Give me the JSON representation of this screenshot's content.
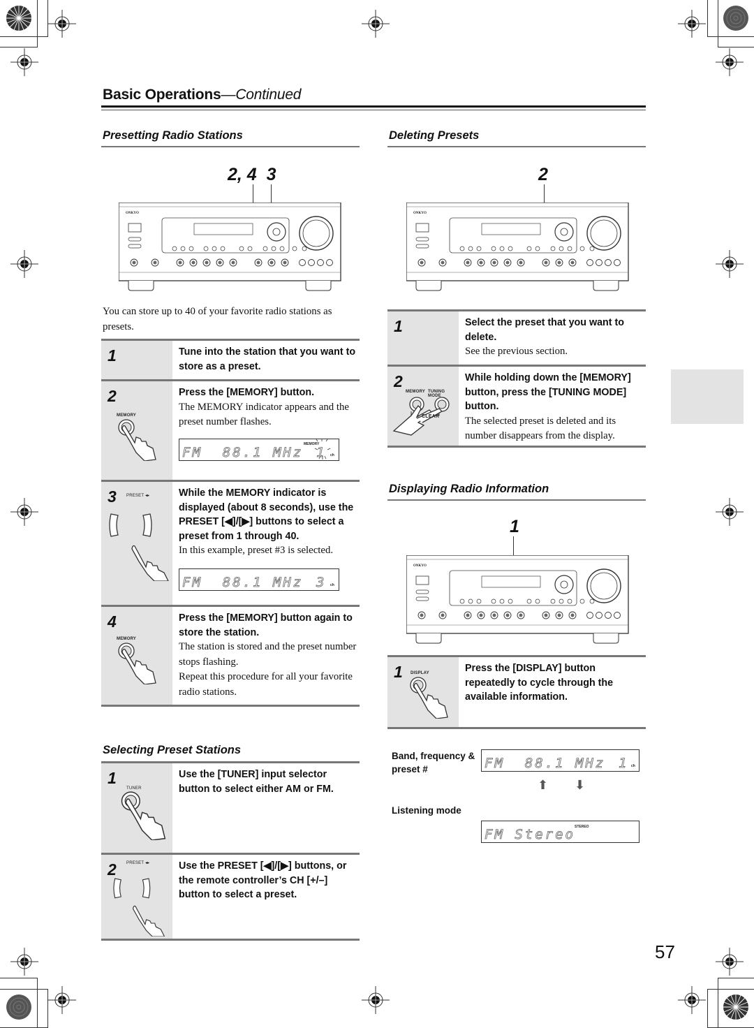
{
  "header": {
    "title": "Basic Operations",
    "continued": "—Continued"
  },
  "presetting": {
    "title": "Presetting Radio Stations",
    "callout": "2, 4  3",
    "receiver": {
      "brand": "ONKYO"
    },
    "intro": "You can store up to 40 of your favorite radio stations as presets.",
    "steps": [
      {
        "num": "1",
        "bold": "Tune into the station that you want to store as a preset.",
        "body": []
      },
      {
        "num": "2",
        "icon_label": "MEMORY",
        "bold": "Press the [MEMORY] button.",
        "body": [
          "The MEMORY indicator appears and the preset number flashes."
        ],
        "display": {
          "text": "FM  88.1 MHz",
          "preset": "1",
          "indicator": "MEMORY",
          "unit": "ch"
        }
      },
      {
        "num": "3",
        "icon_label": "PRESET ◂▸",
        "bold": "While the MEMORY indicator is displayed (about 8 seconds), use the PRESET [◀]/[▶] buttons to select a preset from 1 through 40.",
        "body": [
          "In this example, preset #3 is selected."
        ],
        "display": {
          "text": "FM  88.1 MHz",
          "preset": "3",
          "unit": "ch"
        }
      },
      {
        "num": "4",
        "icon_label": "MEMORY",
        "bold": "Press the [MEMORY] button again to store the station.",
        "body": [
          "The station is stored and the preset number stops flashing.",
          "Repeat this procedure for all your favorite radio stations."
        ]
      }
    ]
  },
  "selecting": {
    "title": "Selecting Preset Stations",
    "steps": [
      {
        "num": "1",
        "icon_label": "TUNER",
        "bold": "Use the [TUNER] input selector button to select either AM or FM."
      },
      {
        "num": "2",
        "icon_label": "PRESET ◂▸",
        "bold": "Use the PRESET [◀]/[▶] buttons, or the remote controller’s CH [+/–] button to select a preset."
      }
    ]
  },
  "deleting": {
    "title": "Deleting Presets",
    "callout": "2",
    "steps": [
      {
        "num": "1",
        "bold": "Select the preset that you want to delete.",
        "body": [
          "See the previous section."
        ]
      },
      {
        "num": "2",
        "icon_labels": [
          "MEMORY",
          "TUNING MODE"
        ],
        "clear_label": "CLEAR",
        "bold": "While holding down the [MEMORY] button, press the [TUNING MODE] button.",
        "body": [
          "The selected preset is deleted and its number disappears from the display."
        ]
      }
    ]
  },
  "displaying": {
    "title": "Displaying Radio Information",
    "callout": "1",
    "steps": [
      {
        "num": "1",
        "icon_label": "DISPLAY",
        "bold": "Press the [DISPLAY] button repeatedly to cycle through the available information."
      }
    ],
    "info": [
      {
        "label": "Band, frequency & preset #",
        "display": "FM  88.1 MHz",
        "preset": "1",
        "unit": "ch"
      },
      {
        "label": "Listening mode",
        "display": "FM Stereo",
        "indicator": "STEREO"
      }
    ]
  },
  "page_number": "57"
}
